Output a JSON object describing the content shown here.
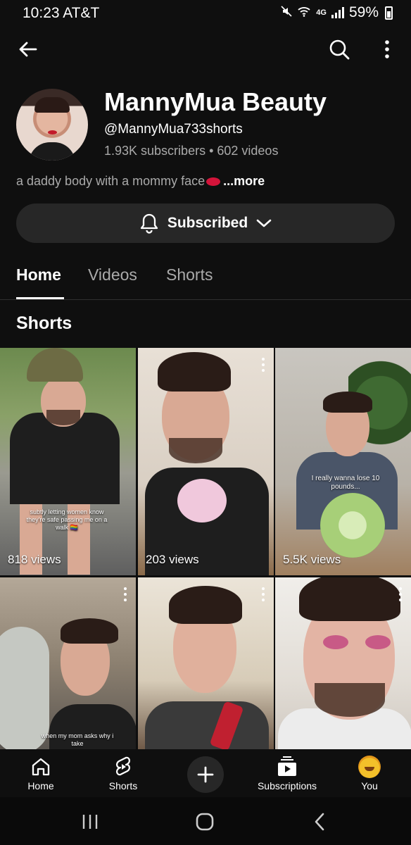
{
  "status": {
    "time": "10:23 AT&T",
    "battery": "59%",
    "network": "4G"
  },
  "channel": {
    "name": "MannyMua Beauty",
    "handle": "@MannyMua733shorts",
    "stats": "1.93K subscribers • 602 videos",
    "description": "a daddy body with a mommy face",
    "more": "...more",
    "subscribe_label": "Subscribed"
  },
  "tabs": [
    {
      "label": "Home",
      "active": true
    },
    {
      "label": "Videos",
      "active": false
    },
    {
      "label": "Shorts",
      "active": false
    }
  ],
  "section": {
    "title": "Shorts"
  },
  "shorts": [
    {
      "views": "818 views",
      "caption": "subtly letting women know they're safe passing me on a walk 🏳️‍🌈"
    },
    {
      "views": "203 views",
      "caption": ""
    },
    {
      "views": "5.5K views",
      "caption": "I really wanna lose 10 pounds..."
    },
    {
      "views": "",
      "caption": "when my mom asks why i take"
    },
    {
      "views": "",
      "caption": ""
    },
    {
      "views": "",
      "caption": ""
    }
  ],
  "bottom_nav": {
    "home": "Home",
    "shorts": "Shorts",
    "subscriptions": "Subscriptions",
    "you": "You"
  },
  "colors": {
    "background": "#0f0f0f",
    "surface": "#272727",
    "secondary_text": "#aaaaaa",
    "accent": "#ffffff"
  }
}
